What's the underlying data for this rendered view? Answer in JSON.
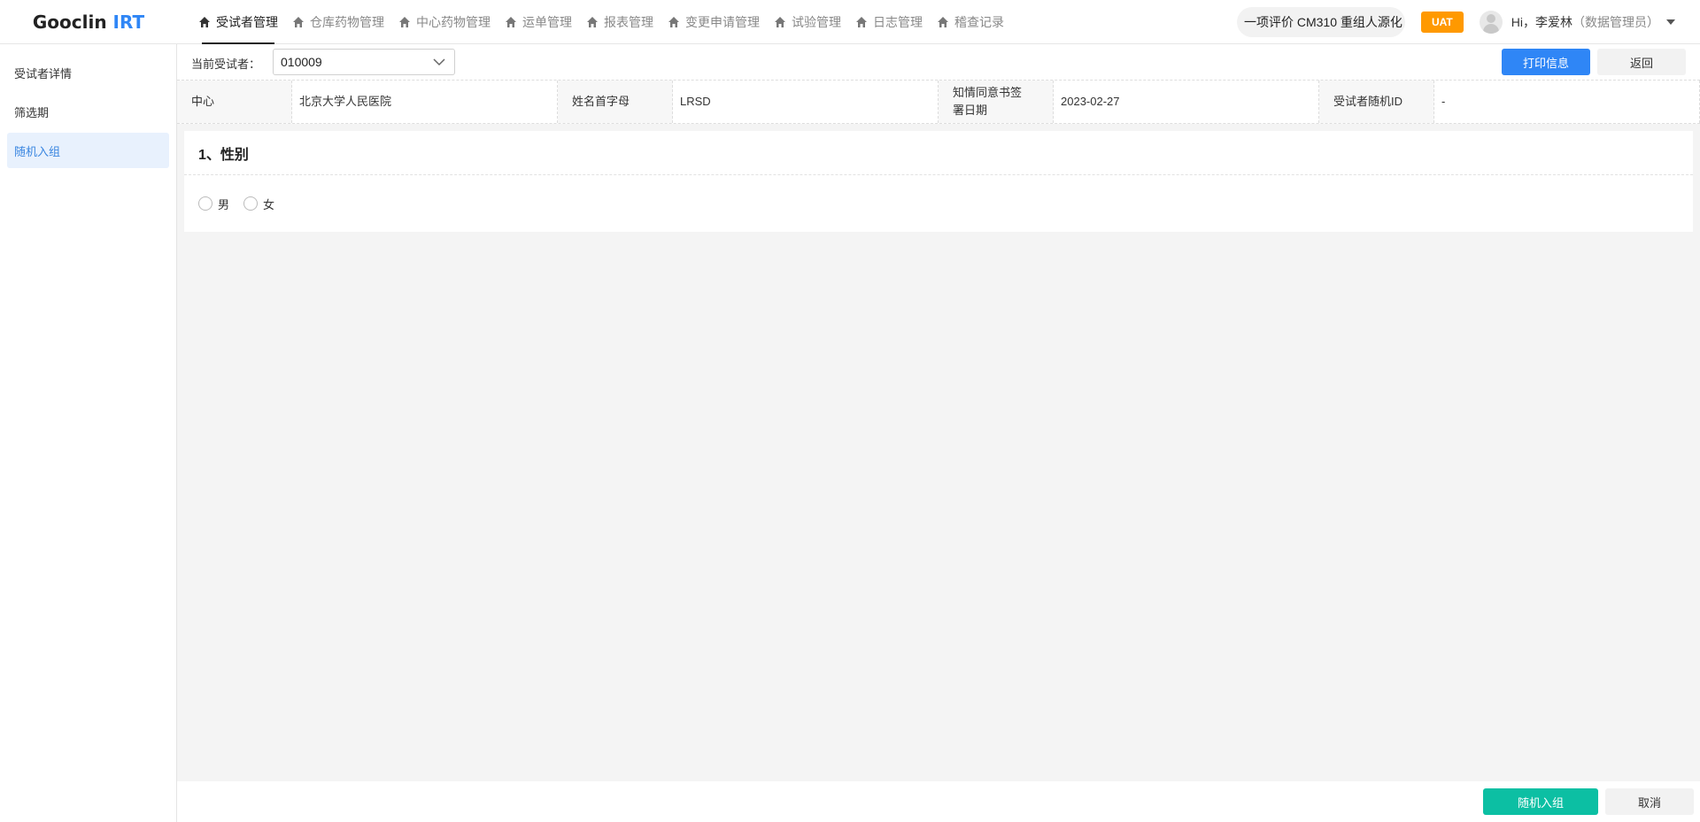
{
  "app": {
    "logo_main": "Gooclin",
    "logo_accent": "IRT"
  },
  "nav": {
    "items": [
      {
        "label": "受试者管理",
        "active": true
      },
      {
        "label": "仓库药物管理"
      },
      {
        "label": "中心药物管理"
      },
      {
        "label": "运单管理"
      },
      {
        "label": "报表管理"
      },
      {
        "label": "变更申请管理"
      },
      {
        "label": "试验管理"
      },
      {
        "label": "日志管理"
      },
      {
        "label": "稽查记录"
      }
    ]
  },
  "header": {
    "project": "一项评价 CM310 重组人源化",
    "env_badge": "UAT",
    "greeting": "Hi，李爱林",
    "role": "（数据管理员）"
  },
  "sidebar": {
    "items": [
      {
        "label": "受试者详情"
      },
      {
        "label": "筛选期"
      },
      {
        "label": "随机入组",
        "active": true
      }
    ]
  },
  "toolbar": {
    "current_label": "当前受试者：",
    "current_subject": "010009",
    "print_label": "打印信息",
    "back_label": "返回"
  },
  "info": {
    "center_label": "中心",
    "center_value": "北京大学人民医院",
    "initials_label": "姓名首字母",
    "initials_value": "LRSD",
    "consent_label": "知情同意书签署日期",
    "consent_value": "2023-02-27",
    "random_id_label": "受试者随机ID",
    "random_id_value": "-"
  },
  "form": {
    "question_title": "1、性别",
    "options": [
      "男",
      "女"
    ]
  },
  "footer": {
    "randomize_label": "随机入组",
    "cancel_label": "取消"
  },
  "colors": {
    "primary": "#2f86f6",
    "accent_green": "#0cbfa3",
    "uat_orange": "#ff9900",
    "sidebar_active_bg": "#e8f1fd"
  }
}
